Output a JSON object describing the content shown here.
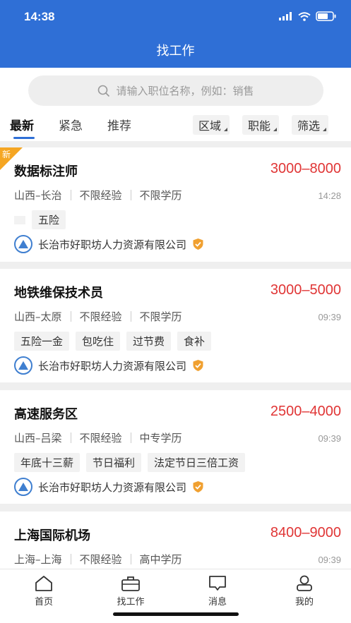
{
  "status_bar": {
    "time": "14:38"
  },
  "header": {
    "title": "找工作"
  },
  "search": {
    "placeholder": "请输入职位名称，例如：销售"
  },
  "tabs": [
    {
      "label": "最新",
      "active": true
    },
    {
      "label": "紧急",
      "active": false
    },
    {
      "label": "推荐",
      "active": false
    }
  ],
  "filters": [
    {
      "label": "区域"
    },
    {
      "label": "职能"
    },
    {
      "label": "筛选"
    }
  ],
  "jobs": [
    {
      "badge": "新",
      "title": "数据标注师",
      "salary": "3000–8000",
      "location": "山西–长治",
      "experience": "不限经验",
      "education": "不限学历",
      "time": "14:28",
      "tags": [
        "五险"
      ],
      "company": "长治市好职坊人力资源有限公司"
    },
    {
      "title": "地铁维保技术员",
      "salary": "3000–5000",
      "location": "山西–太原",
      "experience": "不限经验",
      "education": "不限学历",
      "time": "09:39",
      "tags": [
        "五险一金",
        "包吃住",
        "过节费",
        "食补"
      ],
      "company": "长治市好职坊人力资源有限公司"
    },
    {
      "title": "高速服务区",
      "salary": "2500–4000",
      "location": "山西–吕梁",
      "experience": "不限经验",
      "education": "中专学历",
      "time": "09:39",
      "tags": [
        "年底十三薪",
        "节日福利",
        "法定节日三倍工资"
      ],
      "company": "长治市好职坊人力资源有限公司"
    },
    {
      "title": "上海国际机场",
      "salary": "8400–9000",
      "location": "上海–上海",
      "experience": "不限经验",
      "education": "高中学历",
      "time": "09:39"
    }
  ],
  "bottom_nav": [
    {
      "label": "首页",
      "icon": "home-icon"
    },
    {
      "label": "找工作",
      "icon": "briefcase-icon"
    },
    {
      "label": "消息",
      "icon": "message-icon"
    },
    {
      "label": "我的",
      "icon": "user-icon"
    }
  ],
  "colors": {
    "brand": "#2f6fd6",
    "salary": "#e03535",
    "badge": "#f5a623",
    "verified": "#f0a030"
  }
}
